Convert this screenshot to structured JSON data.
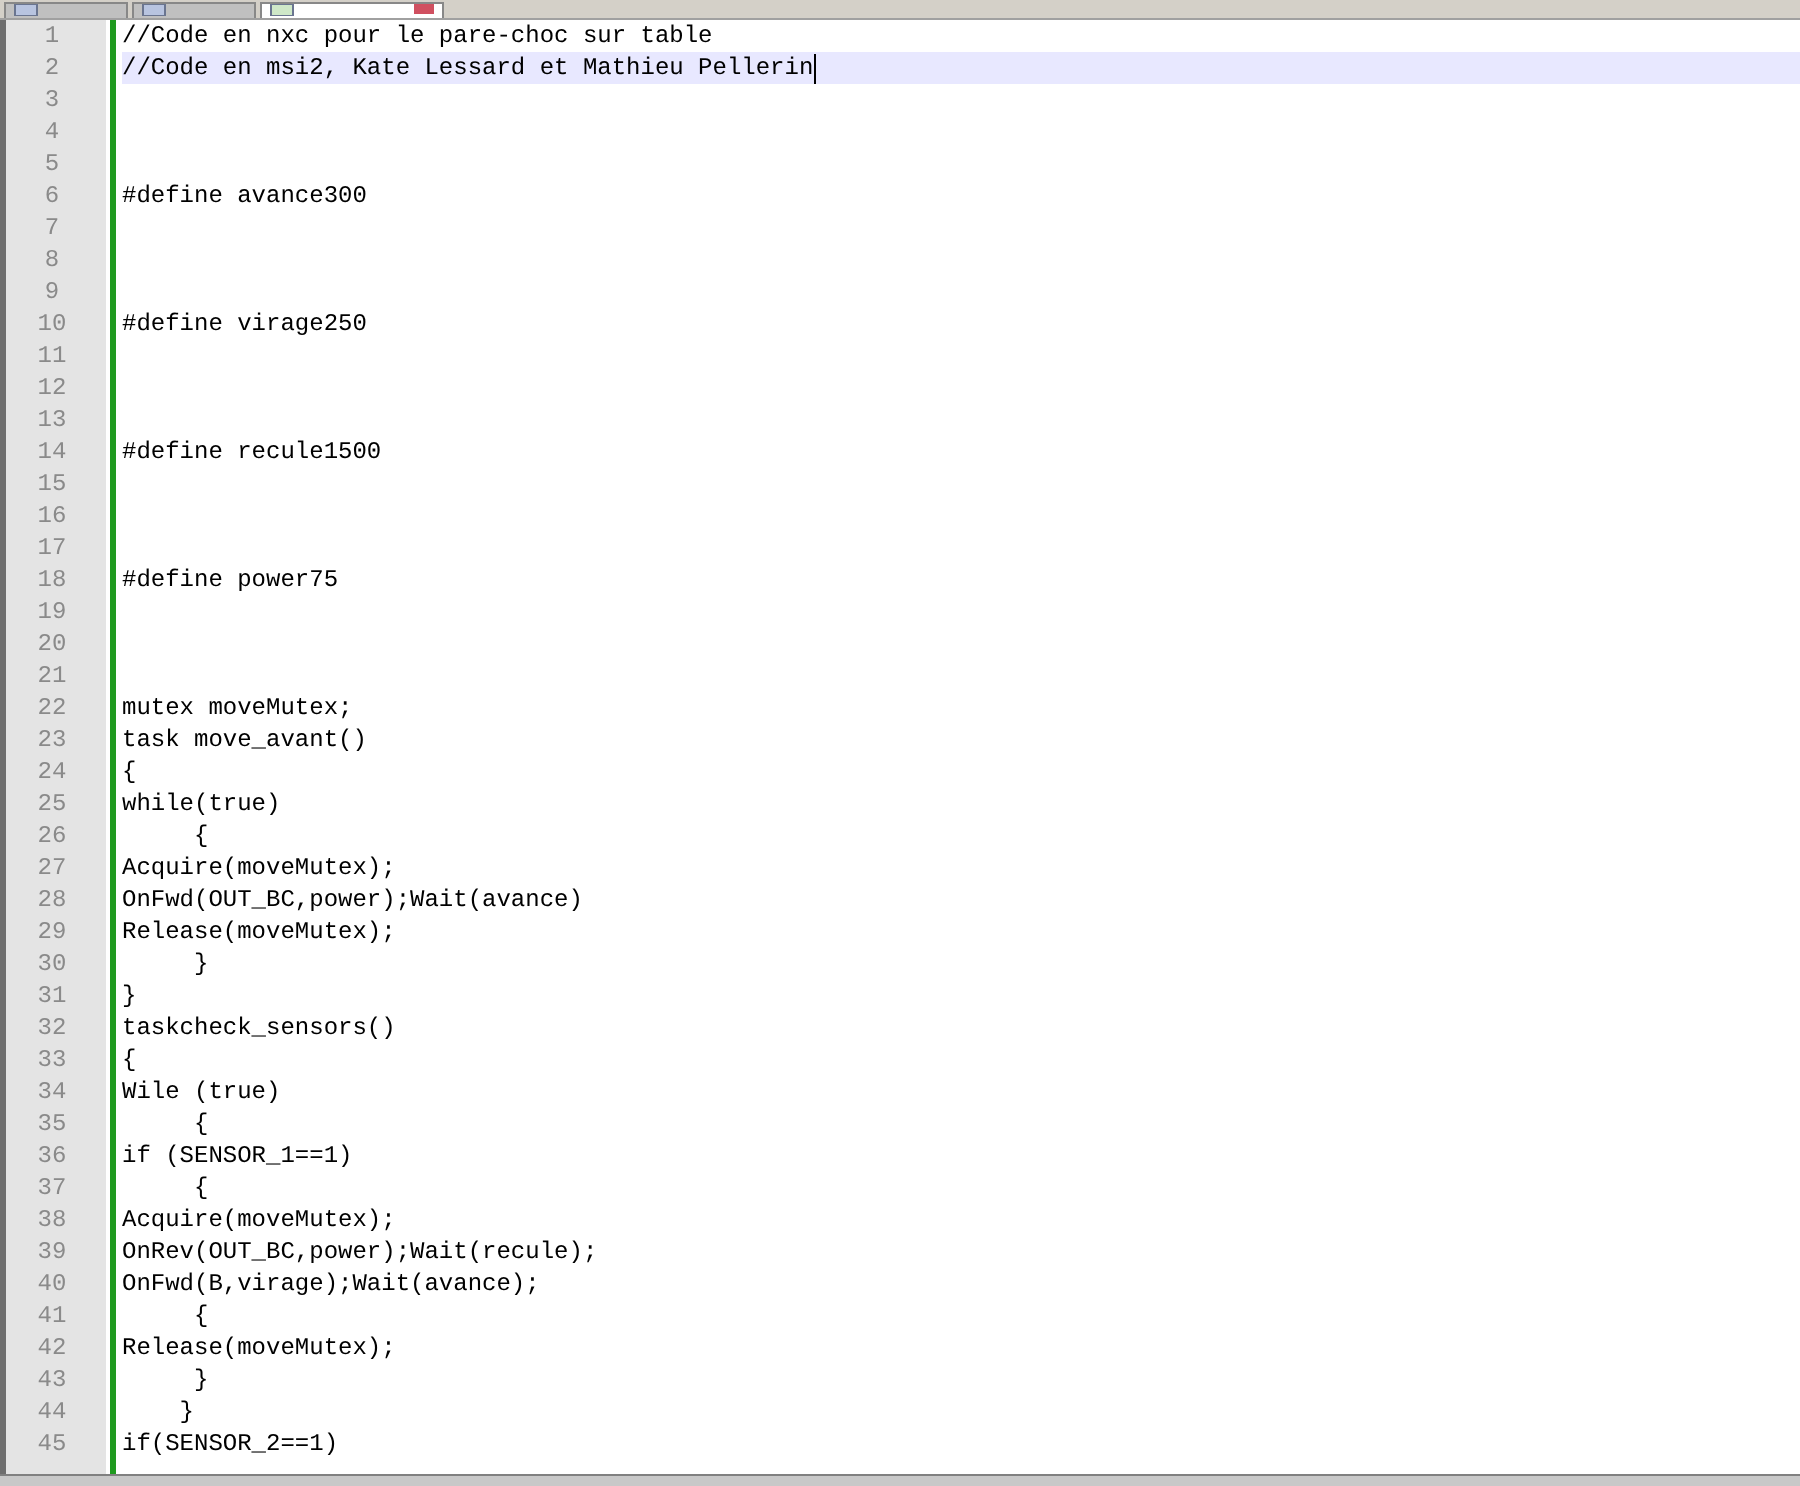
{
  "tabs": [
    {
      "selected": false
    },
    {
      "selected": false
    },
    {
      "selected": true
    }
  ],
  "editor": {
    "lines": [
      {
        "number": "1",
        "text": "//Code en nxc pour le pare-choc sur table",
        "current": false
      },
      {
        "number": "2",
        "text": "//Code en msi2, Kate Lessard et Mathieu Pellerin",
        "current": true
      },
      {
        "number": "3",
        "current": false
      },
      {
        "number": "4",
        "current": false
      },
      {
        "number": "5",
        "current": false
      },
      {
        "number": "6",
        "text": "#define avance300",
        "current": false
      },
      {
        "number": "7",
        "current": false
      },
      {
        "number": "8",
        "current": false
      },
      {
        "number": "9",
        "current": false
      },
      {
        "number": "10",
        "text": "#define virage250",
        "current": false
      },
      {
        "number": "11",
        "current": false
      },
      {
        "number": "12",
        "current": false
      },
      {
        "number": "13",
        "current": false
      },
      {
        "number": "14",
        "text": "#define recule1500",
        "current": false
      },
      {
        "number": "15",
        "current": false
      },
      {
        "number": "16",
        "current": false
      },
      {
        "number": "17",
        "current": false
      },
      {
        "number": "18",
        "text": "#define power75",
        "current": false
      },
      {
        "number": "19",
        "current": false
      },
      {
        "number": "20",
        "current": false
      },
      {
        "number": "21",
        "current": false
      },
      {
        "number": "22",
        "text": "mutex moveMutex;",
        "current": false
      },
      {
        "number": "23",
        "text": "task move_avant()",
        "current": false
      },
      {
        "number": "24",
        "text": "{",
        "current": false
      },
      {
        "number": "25",
        "text": "while(true)",
        "current": false
      },
      {
        "number": "26",
        "text": "     {",
        "current": false
      },
      {
        "number": "27",
        "text": "Acquire(moveMutex);",
        "current": false
      },
      {
        "number": "28",
        "text": "OnFwd(OUT_BC,power);Wait(avance)",
        "current": false
      },
      {
        "number": "29",
        "text": "Release(moveMutex);",
        "current": false
      },
      {
        "number": "30",
        "text": "     }",
        "current": false
      },
      {
        "number": "31",
        "text": "}",
        "current": false
      },
      {
        "number": "32",
        "text": "taskcheck_sensors()",
        "current": false
      },
      {
        "number": "33",
        "text": "{",
        "current": false
      },
      {
        "number": "34",
        "text": "Wile (true)",
        "current": false
      },
      {
        "number": "35",
        "text": "     {",
        "current": false
      },
      {
        "number": "36",
        "text": "if (SENSOR_1==1)",
        "current": false
      },
      {
        "number": "37",
        "text": "     {",
        "current": false
      },
      {
        "number": "38",
        "text": "Acquire(moveMutex);",
        "current": false
      },
      {
        "number": "39",
        "text": "OnRev(OUT_BC,power);Wait(recule);",
        "current": false
      },
      {
        "number": "40",
        "text": "OnFwd(B,virage);Wait(avance);",
        "current": false
      },
      {
        "number": "41",
        "text": "     {",
        "current": false
      },
      {
        "number": "42",
        "text": "Release(moveMutex);",
        "current": false
      },
      {
        "number": "43",
        "text": "     }",
        "current": false
      },
      {
        "number": "44",
        "text": "    }",
        "current": false
      },
      {
        "number": "45",
        "text": "if(SENSOR_2==1)",
        "current": false
      }
    ]
  }
}
